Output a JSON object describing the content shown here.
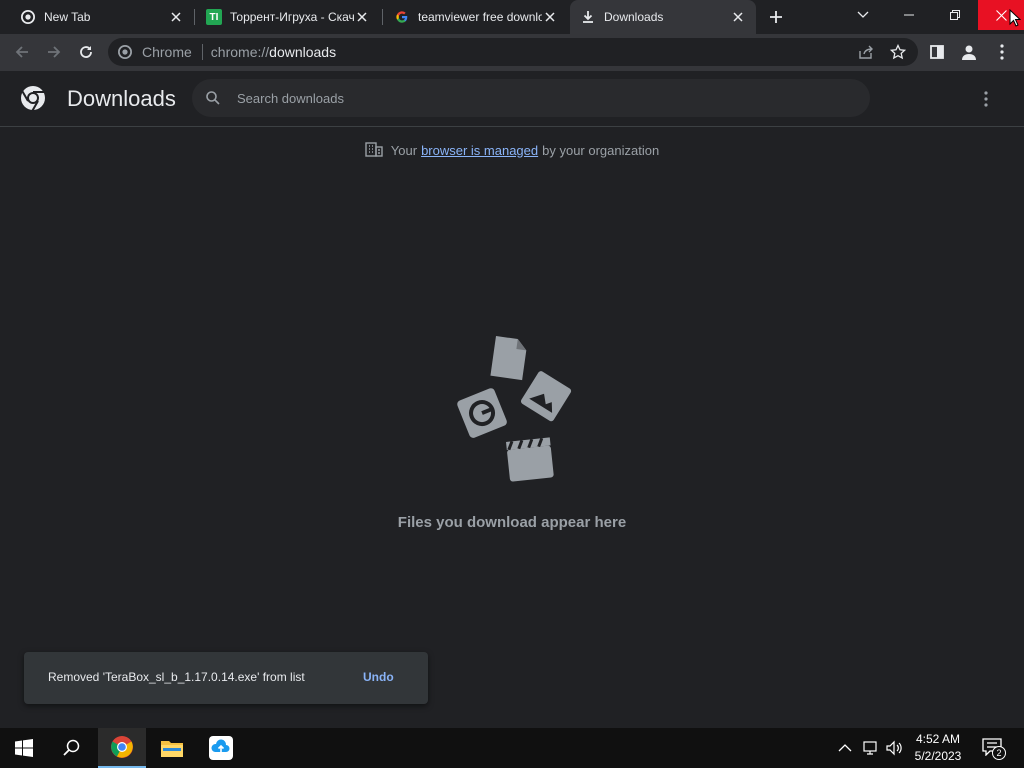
{
  "tabs": [
    {
      "title": "New Tab",
      "icon": "chrome-icon"
    },
    {
      "title": "Торрент-Игруха - Скачать",
      "icon": "torrent-igruha-icon"
    },
    {
      "title": "teamviewer free download",
      "icon": "google-icon"
    },
    {
      "title": "Downloads",
      "icon": "download-icon",
      "active": true
    }
  ],
  "toolbar": {
    "omnibox_chip": "Chrome",
    "url_scheme": "chrome://",
    "url_host": "downloads"
  },
  "page": {
    "title": "Downloads",
    "search_placeholder": "Search downloads",
    "managed_prefix": "Your",
    "managed_link": "browser is managed",
    "managed_suffix": "by your organization",
    "empty_text": "Files you download appear here"
  },
  "toast": {
    "message": "Removed 'TeraBox_sl_b_1.17.0.14.exe' from list",
    "action": "Undo"
  },
  "taskbar": {
    "time": "4:52 AM",
    "date": "5/2/2023",
    "notification_count": "2"
  },
  "colors": {
    "background": "#202124",
    "toolbar": "#35363a",
    "accent_link": "#8ab4f8",
    "close_hover": "#e81123"
  }
}
